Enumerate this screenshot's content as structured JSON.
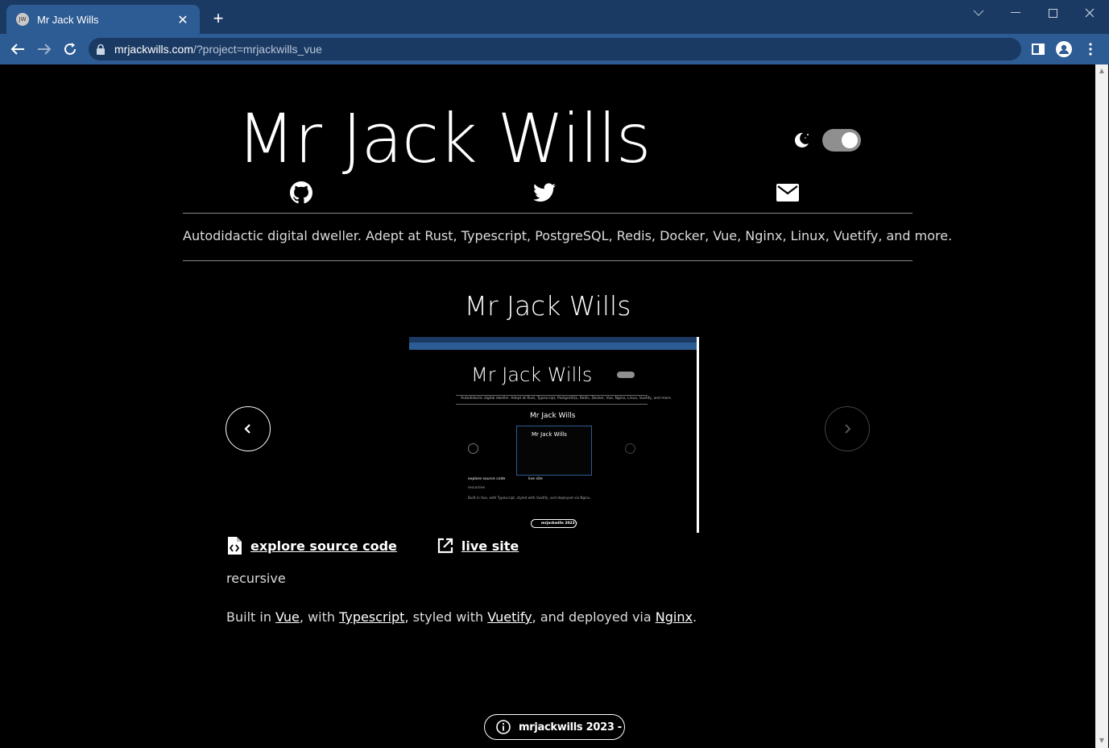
{
  "browser": {
    "tab_title": "Mr Jack Wills",
    "tab_favicon": "JW",
    "url_host": "mrjackwills.com",
    "url_path": "/?project=mrjackwills_vue"
  },
  "header": {
    "title": "Mr Jack Wills",
    "tagline": "Autodidactic digital dweller. Adept at Rust, Typescript, PostgreSQL, Redis, Docker, Vue, Nginx, Linux, Vuetify, and more."
  },
  "project": {
    "title": "Mr Jack Wills",
    "source_link": "explore source code",
    "live_link": "live site",
    "description": "recursive",
    "built_prefix": "Built in ",
    "tech1": "Vue",
    "sep1": ", with ",
    "tech2": "Typescript",
    "sep2": ", styled with ",
    "tech3": "Vuetify",
    "sep3": ", and deployed via ",
    "tech4": "Nginx",
    "built_suffix": "."
  },
  "screenshot": {
    "title": "Mr Jack Wills",
    "project_title": "Mr Jack Wills",
    "inner_title": "Mr Jack Wills",
    "tagline": "Autodidactic digital dweller. Adept at Rust, Typescript, PostgreSQL, Redis, Docker, Vue, Nginx, Linux, Vuetify, and more.",
    "source_link": "explore source code",
    "live_link": "live site",
    "description": "recursive",
    "built": "Built in Vue, with Typescript, styled with Vuetify, and deployed via Nginx.",
    "footer": "mrjackwills 2023 -"
  },
  "footer": {
    "text": "mrjackwills 2023 -"
  },
  "colors": {
    "chrome_dark": "#1b3a63",
    "chrome_light": "#2d5b93",
    "page_bg": "#000000",
    "toggle_track": "#8f8f8f"
  }
}
